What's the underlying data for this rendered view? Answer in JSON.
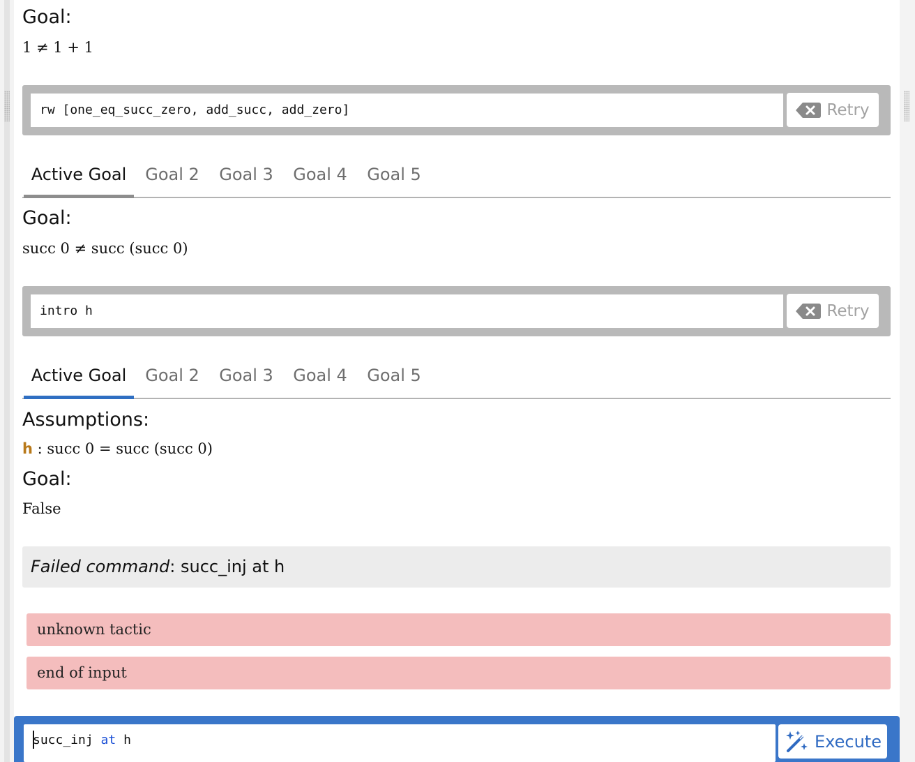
{
  "colors": {
    "accent_blue": "#3a76c9",
    "tab_underline_inactive": "#8d8d8d",
    "tab_underline_active": "#2f6fc2",
    "error_bg": "#f4bdbd",
    "hypothesis_name": "#b8791a"
  },
  "step1": {
    "goal_heading": "Goal:",
    "goal_expr": "1 ≠ 1 + 1",
    "command": "rw [one_eq_succ_zero, add_succ, add_zero]",
    "retry_label": "Retry",
    "retry_icon": "backspace-x-icon"
  },
  "step2": {
    "tabs": [
      "Active Goal",
      "Goal 2",
      "Goal 3",
      "Goal 4",
      "Goal 5"
    ],
    "active_tab_index": 0,
    "goal_heading": "Goal:",
    "goal_expr": "succ 0 ≠ succ (succ 0)",
    "command": "intro h",
    "retry_label": "Retry",
    "retry_icon": "backspace-x-icon"
  },
  "step3": {
    "tabs": [
      "Active Goal",
      "Goal 2",
      "Goal 3",
      "Goal 4",
      "Goal 5"
    ],
    "active_tab_index": 0,
    "assumptions_heading": "Assumptions:",
    "assumption_name": "h",
    "assumption_separator": ":",
    "assumption_expr": "succ 0 = succ (succ 0)",
    "goal_heading": "Goal:",
    "goal_expr": "False"
  },
  "failed": {
    "label": "Failed command",
    "separator": ":",
    "command": "succ_inj at h"
  },
  "errors": [
    "unknown tactic",
    "end of input"
  ],
  "input": {
    "tokens": [
      "succ_inj",
      "at",
      "h"
    ],
    "execute_label": "Execute",
    "execute_icon": "magic-wand-icon"
  }
}
